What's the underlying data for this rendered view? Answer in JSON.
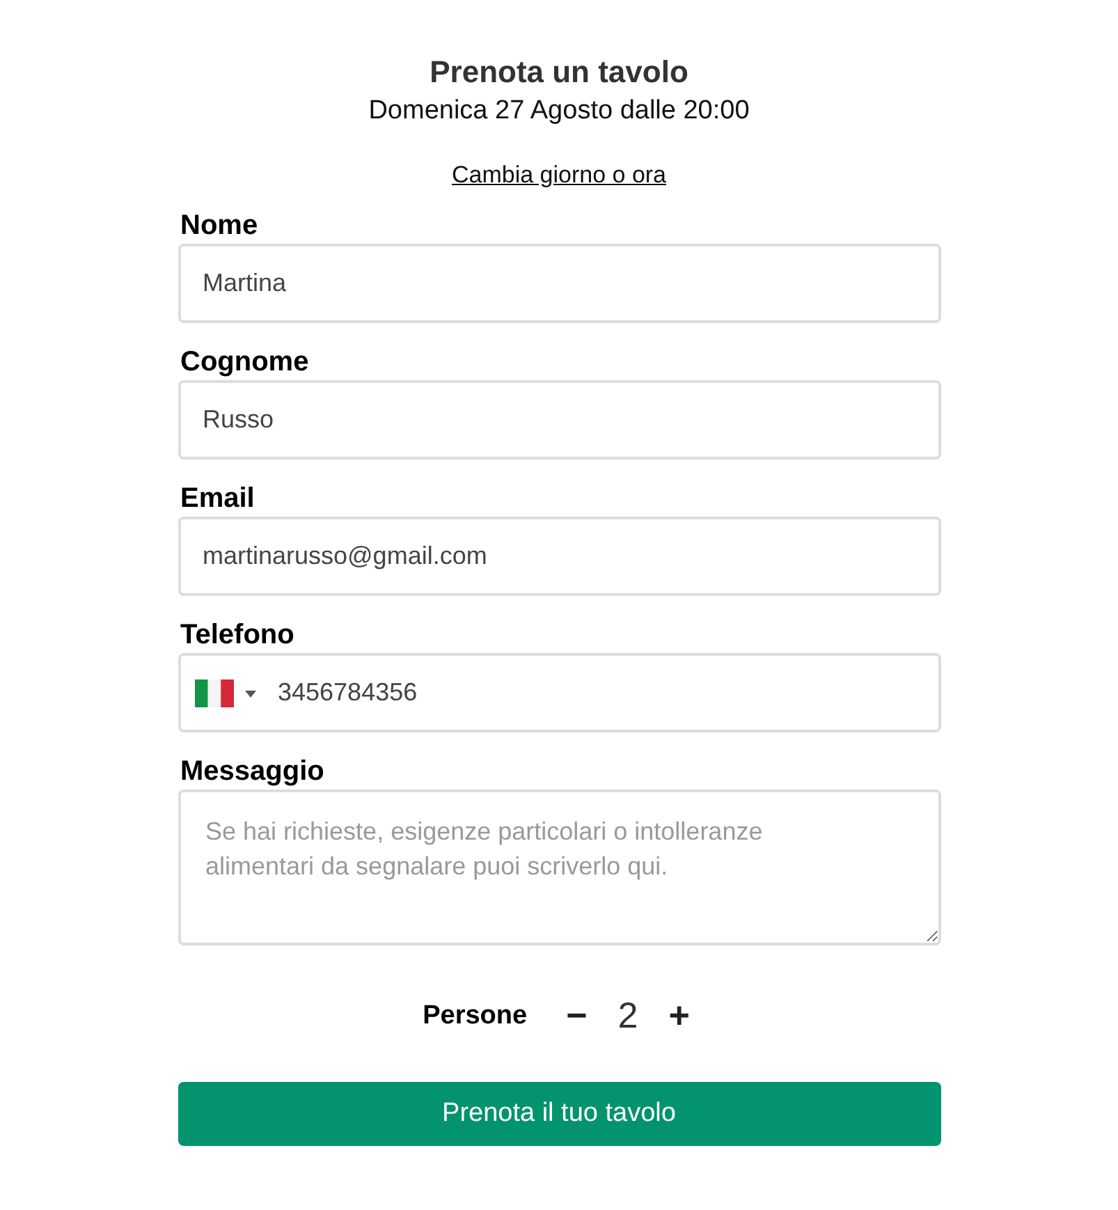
{
  "header": {
    "title": "Prenota un tavolo",
    "subtitle": "Domenica 27 Agosto dalle 20:00",
    "change_link": "Cambia giorno o ora"
  },
  "fields": [
    {
      "kind": "text",
      "label": "Nome",
      "value": "Martina"
    },
    {
      "kind": "text",
      "label": "Cognome",
      "value": "Russo"
    },
    {
      "kind": "text",
      "label": "Email",
      "value": "martinarusso@gmail.com"
    },
    {
      "kind": "phone",
      "label": "Telefono",
      "value": "3456784356"
    },
    {
      "kind": "textarea",
      "label": "Messaggio",
      "placeholder": "Se hai richieste, esigenze particolari o intolleranze alimentari da segnalare puoi scriverlo qui."
    }
  ],
  "guests": {
    "label": "Persone",
    "decrement": "−",
    "count": "2",
    "increment": "+"
  },
  "submit_button": "Prenota il tuo tavolo"
}
